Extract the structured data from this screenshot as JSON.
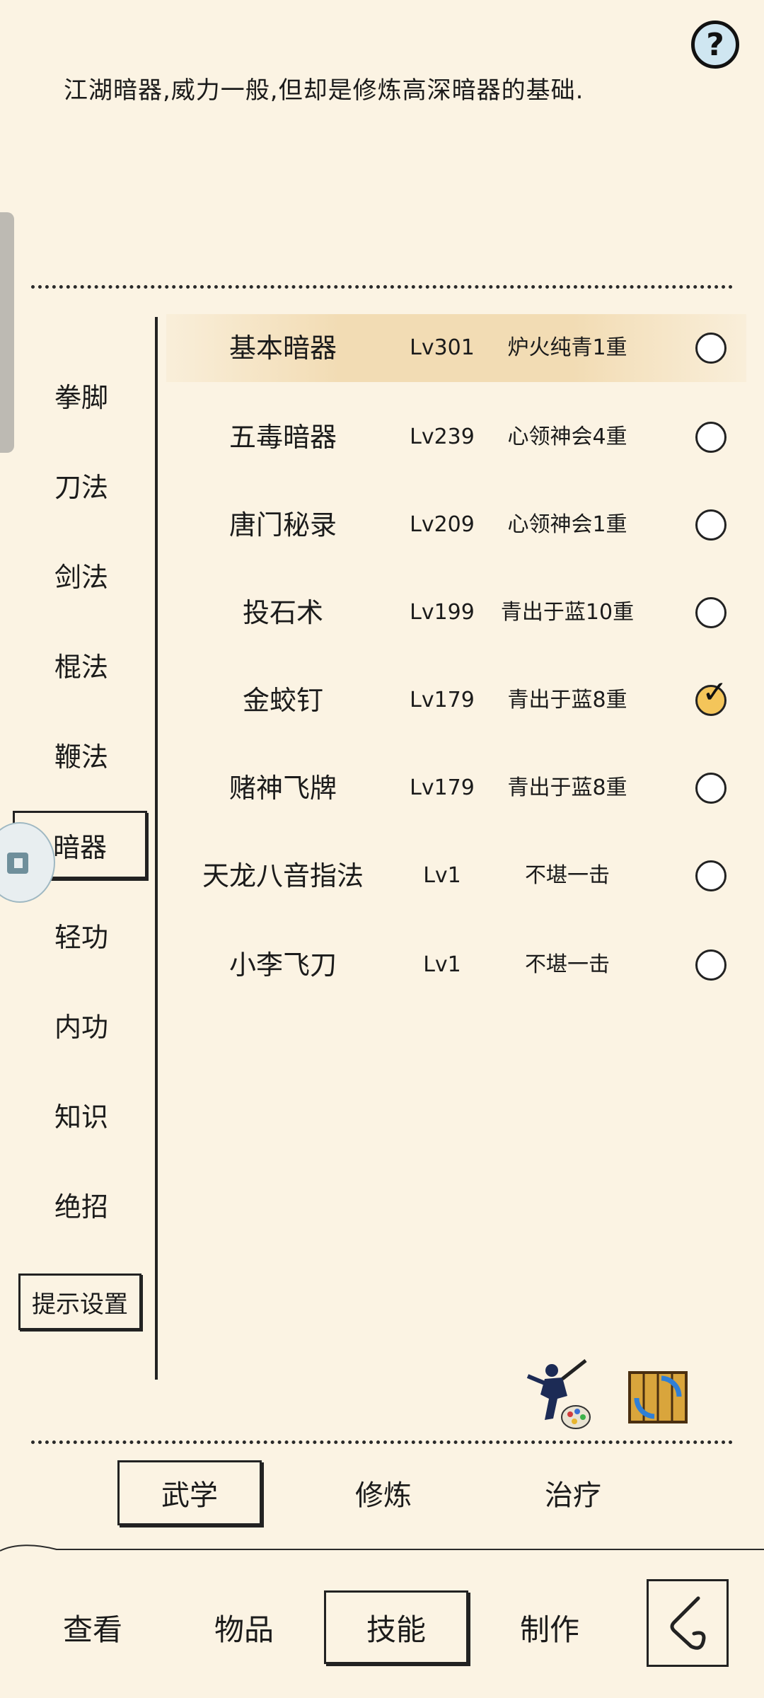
{
  "description": "江湖暗器,威力一般,但却是修炼高深暗器的基础.",
  "help_label": "?",
  "categories": [
    "拳脚",
    "刀法",
    "剑法",
    "棍法",
    "鞭法",
    "暗器",
    "轻功",
    "内功",
    "知识",
    "绝招"
  ],
  "active_category": "暗器",
  "settings_label": "提示设置",
  "skills": [
    {
      "name": "基本暗器",
      "level": "Lv301",
      "rank": "炉火纯青1重",
      "checked": false
    },
    {
      "name": "五毒暗器",
      "level": "Lv239",
      "rank": "心领神会4重",
      "checked": false
    },
    {
      "name": "唐门秘录",
      "level": "Lv209",
      "rank": "心领神会1重",
      "checked": false
    },
    {
      "name": "投石术",
      "level": "Lv199",
      "rank": "青出于蓝10重",
      "checked": false
    },
    {
      "name": "金蛟钉",
      "level": "Lv179",
      "rank": "青出于蓝8重",
      "checked": true
    },
    {
      "name": "赌神飞牌",
      "level": "Lv179",
      "rank": "青出于蓝8重",
      "checked": false
    },
    {
      "name": "天龙八音指法",
      "level": "Lv1",
      "rank": "不堪一击",
      "checked": false
    },
    {
      "name": "小李飞刀",
      "level": "Lv1",
      "rank": "不堪一击",
      "checked": false
    }
  ],
  "check_glyph": "✓",
  "subtabs": [
    "武学",
    "修炼",
    "治疗"
  ],
  "active_subtab": "武学",
  "bottom_tabs": [
    "查看",
    "物品",
    "技能",
    "制作"
  ],
  "active_bottom_tab": "技能",
  "icons": {
    "help": "question-icon",
    "fighter": "fighter-palette-icon",
    "scroll": "scroll-swap-icon",
    "back": "back-arrow-icon",
    "floating": "floating-assistant-icon"
  }
}
